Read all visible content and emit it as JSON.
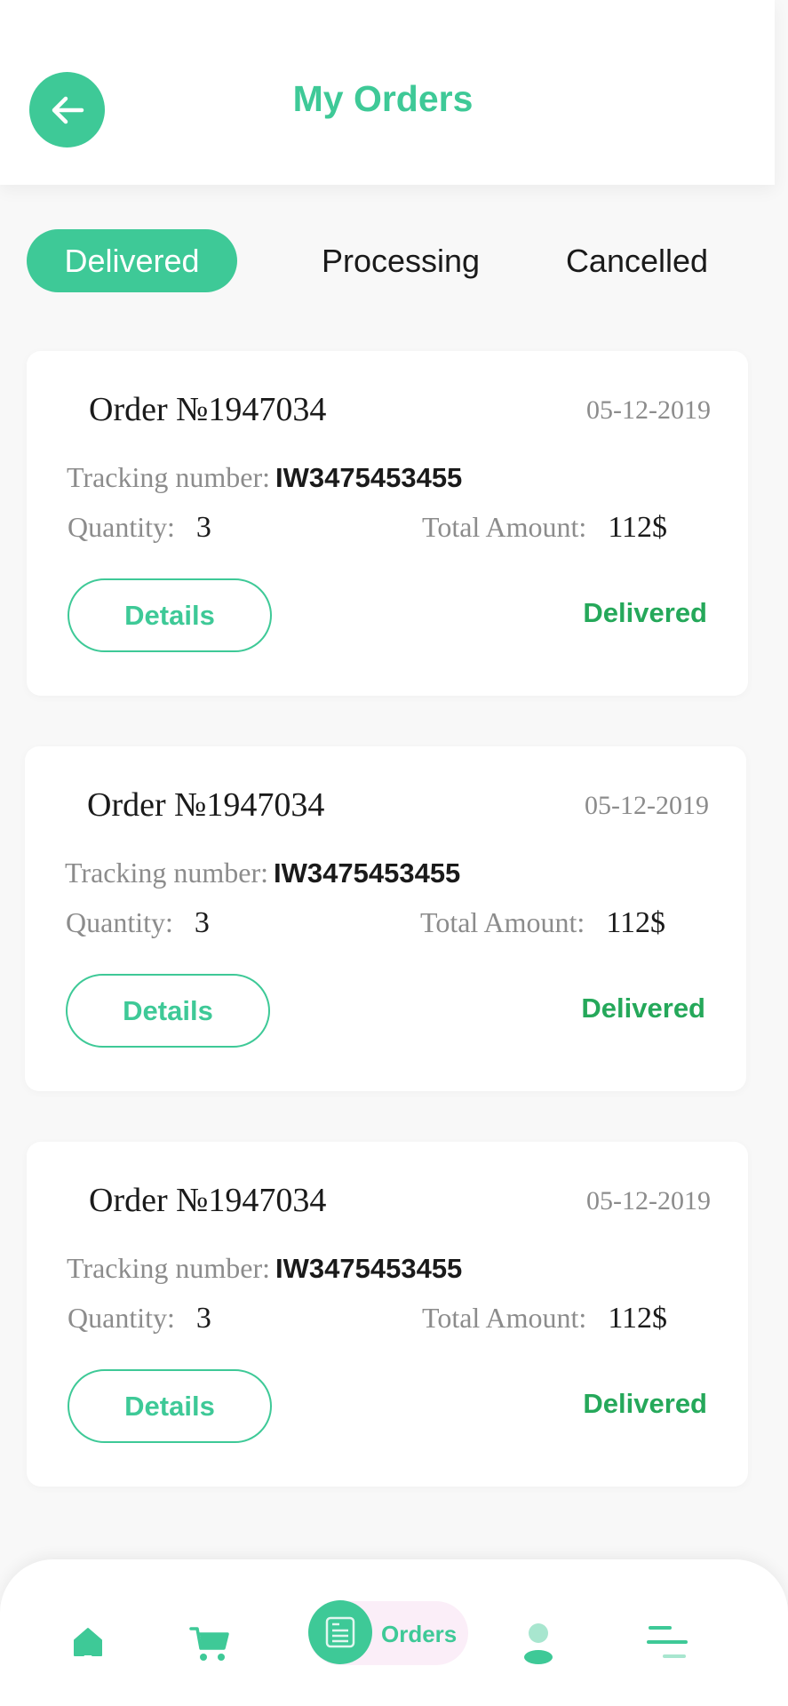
{
  "header": {
    "title": "My Orders",
    "back_icon": "arrow-left-icon"
  },
  "tabs": [
    {
      "label": "Delivered",
      "active": true
    },
    {
      "label": "Processing",
      "active": false
    },
    {
      "label": "Cancelled",
      "active": false
    }
  ],
  "orders": [
    {
      "order_number": "Order №1947034",
      "date": "05-12-2019",
      "tracking_label": "Tracking number:",
      "tracking_number": "IW3475453455",
      "quantity_label": "Quantity:",
      "quantity": "3",
      "total_label": "Total Amount:",
      "total": "112$",
      "details_label": "Details",
      "status": "Delivered"
    },
    {
      "order_number": "Order №1947034",
      "date": "05-12-2019",
      "tracking_label": "Tracking number:",
      "tracking_number": "IW3475453455",
      "quantity_label": "Quantity:",
      "quantity": "3",
      "total_label": "Total Amount:",
      "total": "112$",
      "details_label": "Details",
      "status": "Delivered"
    },
    {
      "order_number": "Order №1947034",
      "date": "05-12-2019",
      "tracking_label": "Tracking number:",
      "tracking_number": "IW3475453455",
      "quantity_label": "Quantity:",
      "quantity": "3",
      "total_label": "Total Amount:",
      "total": "112$",
      "details_label": "Details",
      "status": "Delivered"
    }
  ],
  "bottom_nav": {
    "items": [
      {
        "icon": "home-icon",
        "label": ""
      },
      {
        "icon": "cart-icon",
        "label": ""
      },
      {
        "icon": "orders-icon",
        "label": "Orders",
        "active": true
      },
      {
        "icon": "profile-icon",
        "label": ""
      },
      {
        "icon": "menu-icon",
        "label": ""
      }
    ]
  },
  "colors": {
    "accent": "#3ec997",
    "status_delivered": "#25a85a",
    "nav_active_pill": "#fbeef8"
  }
}
